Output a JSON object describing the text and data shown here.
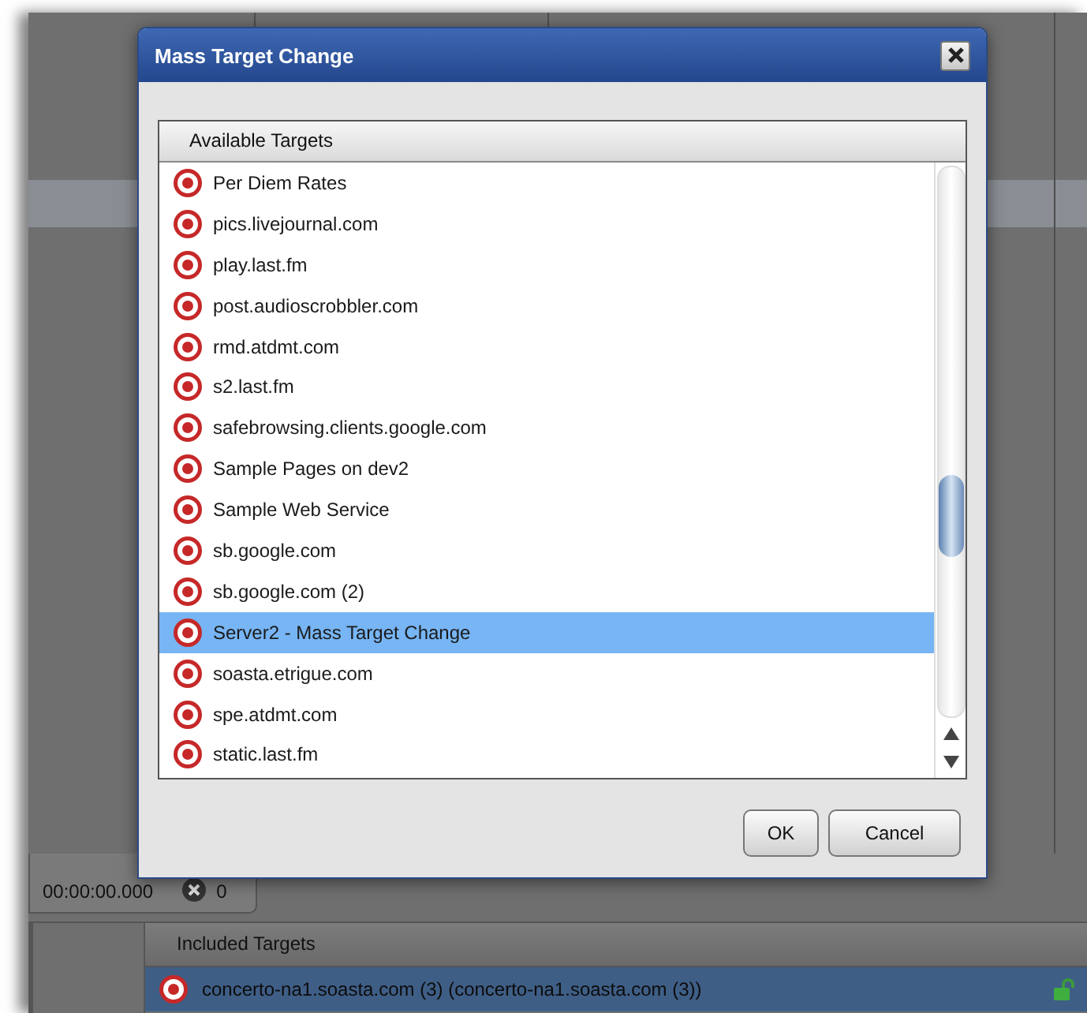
{
  "dialog": {
    "title": "Mass Target Change",
    "list_header": "Available Targets",
    "items": [
      {
        "label": "Per Diem Rates",
        "selected": false
      },
      {
        "label": "pics.livejournal.com",
        "selected": false
      },
      {
        "label": "play.last.fm",
        "selected": false
      },
      {
        "label": "post.audioscrobbler.com",
        "selected": false
      },
      {
        "label": "rmd.atdmt.com",
        "selected": false
      },
      {
        "label": "s2.last.fm",
        "selected": false
      },
      {
        "label": "safebrowsing.clients.google.com",
        "selected": false
      },
      {
        "label": "Sample Pages on dev2",
        "selected": false
      },
      {
        "label": "Sample Web Service",
        "selected": false
      },
      {
        "label": "sb.google.com",
        "selected": false
      },
      {
        "label": "sb.google.com (2)",
        "selected": false
      },
      {
        "label": "Server2 - Mass Target Change",
        "selected": true
      },
      {
        "label": "soasta.etrigue.com",
        "selected": false
      },
      {
        "label": "spe.atdmt.com",
        "selected": false
      },
      {
        "label": "static.last.fm",
        "selected": false
      }
    ],
    "buttons": [
      "OK",
      "Cancel"
    ]
  },
  "background": {
    "timer": "00:00:00.000",
    "error_count": "0",
    "included_header": "Included Targets",
    "included_rows": [
      {
        "label": "concerto-na1.soasta.com (3) (concerto-na1.soasta.com (3))",
        "selected": true
      }
    ]
  }
}
